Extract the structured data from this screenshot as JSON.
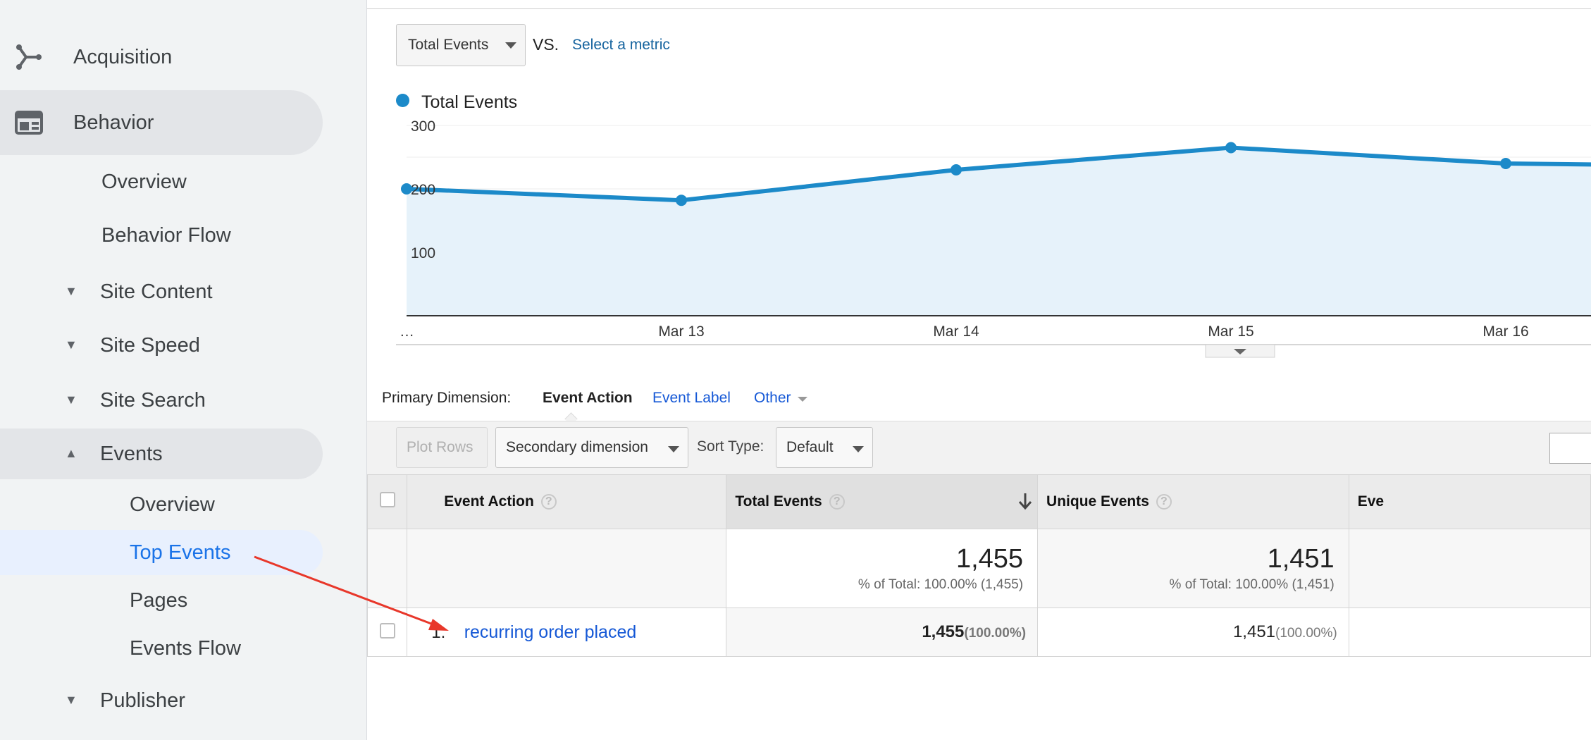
{
  "sidebar": {
    "acquisition": "Acquisition",
    "behavior": "Behavior",
    "overview": "Overview",
    "behavior_flow": "Behavior Flow",
    "site_content": "Site Content",
    "site_speed": "Site Speed",
    "site_search": "Site Search",
    "events": "Events",
    "events_overview": "Overview",
    "top_events": "Top Events",
    "pages": "Pages",
    "events_flow": "Events Flow",
    "publisher": "Publisher"
  },
  "chart_controls": {
    "metric": "Total Events",
    "vs": "VS.",
    "select_metric": "Select a metric",
    "legend": "Total Events"
  },
  "chart_data": {
    "type": "area",
    "categories": [
      "…",
      "Mar 13",
      "Mar 14",
      "Mar 15",
      "Mar 16"
    ],
    "series": [
      {
        "name": "Total Events",
        "values": [
          200,
          182,
          230,
          265,
          240,
          235
        ]
      }
    ],
    "yticks": [
      "300",
      "200",
      "100"
    ],
    "ylim": [
      0,
      300
    ],
    "color": "#1c8ac9",
    "fill": "#e6f2fa"
  },
  "dimension": {
    "label": "Primary Dimension:",
    "active": "Event Action",
    "event_label": "Event Label",
    "other": "Other"
  },
  "toolbar": {
    "plot_rows": "Plot Rows",
    "secondary": "Secondary dimension",
    "sort_type": "Sort Type:",
    "sort_value": "Default"
  },
  "table": {
    "headers": {
      "action": "Event Action",
      "total": "Total Events",
      "unique": "Unique Events",
      "ev": "Eve"
    },
    "totals": {
      "total": "1,455",
      "total_pct": "% of Total: 100.00% (1,455)",
      "unique": "1,451",
      "unique_pct": "% of Total: 100.00% (1,451)"
    },
    "rows": [
      {
        "num": "1.",
        "action": "recurring order placed",
        "total": "1,455",
        "total_pct": "(100.00%)",
        "unique": "1,451",
        "unique_pct": "(100.00%)"
      }
    ]
  }
}
